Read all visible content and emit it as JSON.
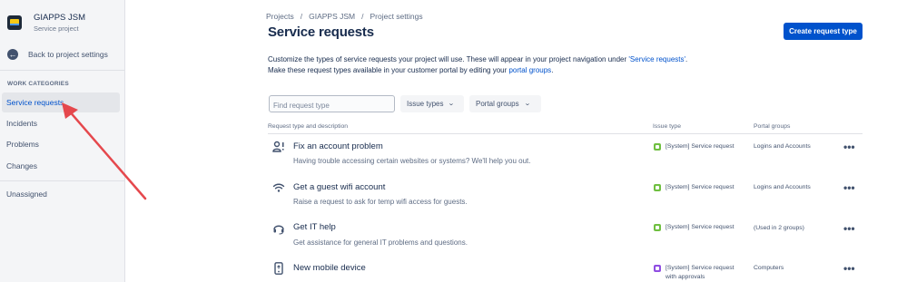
{
  "sidebar": {
    "project_name": "GIAPPS JSM",
    "project_type": "Service project",
    "back_label": "Back to project settings",
    "section_heading": "WORK CATEGORIES",
    "items": [
      {
        "label": "Service requests"
      },
      {
        "label": "Incidents"
      },
      {
        "label": "Problems"
      },
      {
        "label": "Changes"
      }
    ],
    "unassigned_label": "Unassigned"
  },
  "breadcrumbs": [
    "Projects",
    "GIAPPS JSM",
    "Project settings"
  ],
  "breadcrumb_separator": "/",
  "page_title": "Service requests",
  "create_button": "Create request type",
  "description": {
    "line1_pre": "Customize the types of service requests your project will use. These will appear in your project navigation under ",
    "line1_link": "'Service requests'",
    "line1_post": ".",
    "line2_pre": "Make these request types available in your customer portal by editing your ",
    "line2_link": "portal groups",
    "line2_post": "."
  },
  "filters": {
    "search_placeholder": "Find request type",
    "issue_types_label": "Issue types",
    "portal_groups_label": "Portal groups"
  },
  "table": {
    "headers": {
      "request_type": "Request type and description",
      "issue_type": "Issue type",
      "portal_groups": "Portal groups"
    },
    "rows": [
      {
        "icon": "account-problem-icon",
        "title": "Fix an account problem",
        "description": "Having trouble accessing certain websites or systems? We'll help you out.",
        "issue_type": "[System] Service request",
        "issue_type_line2": "",
        "issue_color": "#6fbf40",
        "portal_groups": "Logins and Accounts"
      },
      {
        "icon": "wifi-icon",
        "title": "Get a guest wifi account",
        "description": "Raise a request to ask for temp wifi access for guests.",
        "issue_type": "[System] Service request",
        "issue_type_line2": "",
        "issue_color": "#6fbf40",
        "portal_groups": "Logins and Accounts"
      },
      {
        "icon": "headset-icon",
        "title": "Get IT help",
        "description": "Get assistance for general IT problems and questions.",
        "issue_type": "[System] Service request",
        "issue_type_line2": "",
        "issue_color": "#6fbf40",
        "portal_groups": "(Used in 2 groups)"
      },
      {
        "icon": "mobile-device-icon",
        "title": "New mobile device",
        "description": "",
        "issue_type": "[System] Service request",
        "issue_type_line2": "with approvals",
        "issue_color": "#904ee2",
        "portal_groups": "Computers"
      }
    ],
    "more_glyph": "•••"
  },
  "annotation_color": "#e5484d"
}
